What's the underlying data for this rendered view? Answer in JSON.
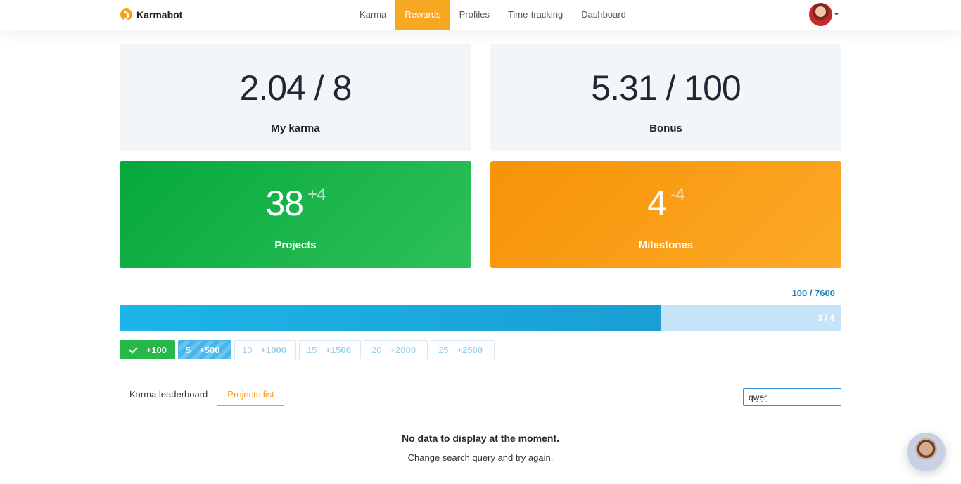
{
  "app": {
    "name": "Karmabot"
  },
  "nav": {
    "links": [
      "Karma",
      "Rewards",
      "Profiles",
      "Time-tracking",
      "Dashboard"
    ],
    "active": "Rewards"
  },
  "cards": {
    "my_karma": {
      "value": "2.04 / 8",
      "label": "My karma"
    },
    "bonus": {
      "value": "5.31 / 100",
      "label": "Bonus"
    },
    "projects": {
      "value": "38",
      "delta": "+4",
      "label": "Projects",
      "color": "#1cb24a"
    },
    "milestones": {
      "value": "4",
      "delta": "-4",
      "label": "Milestones",
      "color": "#f89c12"
    }
  },
  "progress": {
    "total": "100 / 7600",
    "steps": "3 / 4",
    "fill_fraction": 0.75
  },
  "rewards": [
    {
      "num": "",
      "points": "+100",
      "state": "done"
    },
    {
      "num": "5",
      "points": "+500",
      "state": "current"
    },
    {
      "num": "10",
      "points": "+1000",
      "state": "locked"
    },
    {
      "num": "15",
      "points": "+1500",
      "state": "locked"
    },
    {
      "num": "20",
      "points": "+2000",
      "state": "locked"
    },
    {
      "num": "25",
      "points": "+2500",
      "state": "locked"
    }
  ],
  "tabs": [
    "Karma leaderboard",
    "Projects list"
  ],
  "active_tab": "Projects list",
  "search": {
    "value": "qwer"
  },
  "empty_state": {
    "title": "No data to display at the moment.",
    "subtitle": "Change search query and try again."
  }
}
